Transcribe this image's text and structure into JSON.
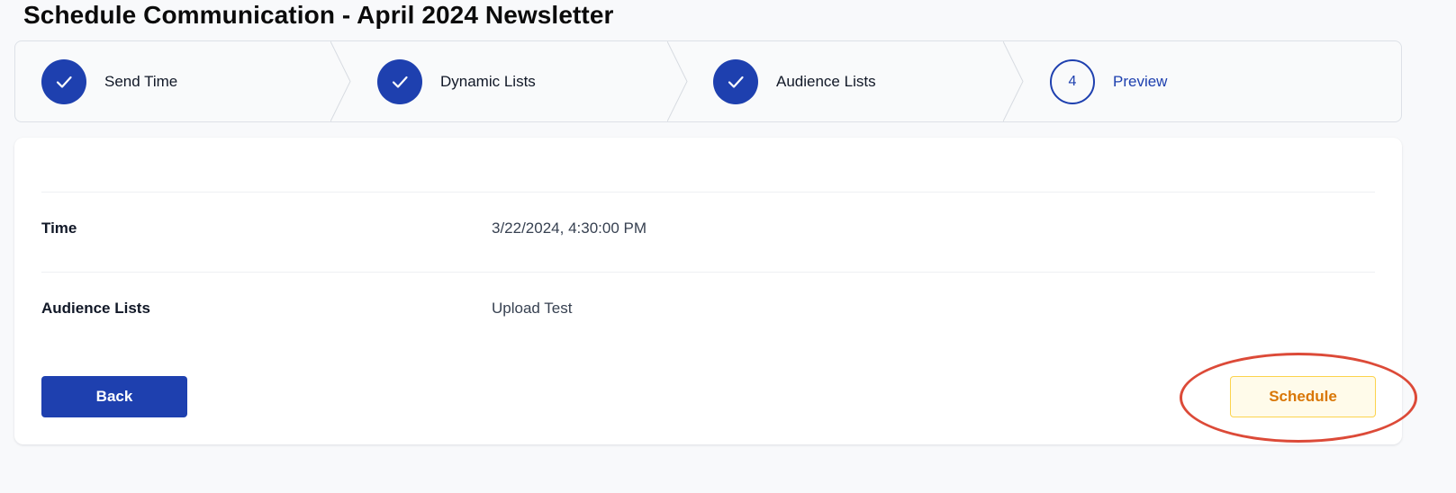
{
  "page": {
    "title": "Schedule Communication - April 2024 Newsletter"
  },
  "stepper": {
    "steps": [
      {
        "label": "Send Time",
        "status": "complete",
        "icon": "check-icon"
      },
      {
        "label": "Dynamic Lists",
        "status": "complete",
        "icon": "check-icon"
      },
      {
        "label": "Audience Lists",
        "status": "complete",
        "icon": "check-icon"
      },
      {
        "label": "Preview",
        "status": "current",
        "number": "4"
      }
    ]
  },
  "summary": {
    "rows": [
      {
        "label": "Time",
        "value": "3/22/2024, 4:30:00 PM"
      },
      {
        "label": "Audience Lists",
        "value": "Upload Test"
      }
    ]
  },
  "actions": {
    "back_label": "Back",
    "schedule_label": "Schedule"
  },
  "colors": {
    "primary": "#1e40af",
    "schedule_text": "#d97706",
    "schedule_bg": "#fffbea",
    "highlight": "#dc4a38"
  }
}
